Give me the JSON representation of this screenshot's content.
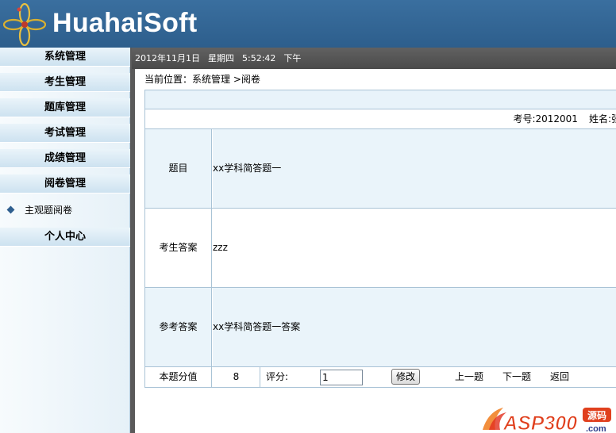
{
  "header": {
    "brand": "HuahaiSoft"
  },
  "sidebar": {
    "sections": [
      {
        "label": "系统管理"
      },
      {
        "label": "考生管理"
      },
      {
        "label": "题库管理"
      },
      {
        "label": "考试管理"
      },
      {
        "label": "成绩管理"
      },
      {
        "label": "阅卷管理"
      },
      {
        "label": "个人中心"
      }
    ],
    "active_item": {
      "label": "主观题阅卷"
    }
  },
  "status_bar": {
    "date": "2012年11月1日",
    "weekday": "星期四",
    "time": "5:52:42",
    "period": "下午"
  },
  "breadcrumb": "当前位置：系统管理 >阅卷",
  "exam_info": {
    "exam_id": "考号:2012001",
    "name": "姓名:张"
  },
  "rows": [
    {
      "label": "题目",
      "value": "xx学科简答题一"
    },
    {
      "label": "考生答案",
      "value": "zzz"
    },
    {
      "label": "参考答案",
      "value": "xx学科简答题一答案"
    }
  ],
  "scoring": {
    "score_label": "本题分值",
    "score_value": "8",
    "grade_label": "评分:",
    "grade_input_value": "1",
    "modify_label": "修改",
    "prev_label": "上一题",
    "next_label": "下一题",
    "back_label": "返回"
  },
  "watermark": {
    "text": "ASP300",
    "badge": "源码",
    "suffix": ".com"
  },
  "colors": {
    "header": "#2d5e8c",
    "sidebar_section": "#cde2f0",
    "table_border": "#a9c3d6",
    "status_bar": "#4a4a4a"
  }
}
